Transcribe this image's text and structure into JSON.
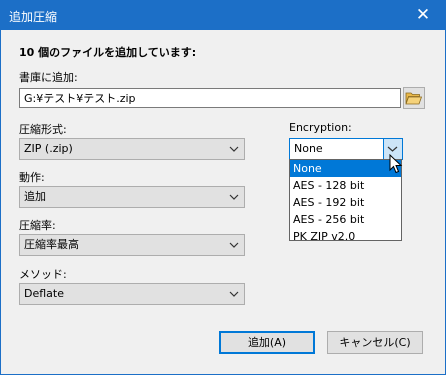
{
  "window": {
    "title": "追加圧縮",
    "close_glyph": "✕"
  },
  "heading": "10 個のファイルを追加しています:",
  "archive": {
    "label": "書庫に追加:",
    "path": "G:¥テスト¥テスト.zip"
  },
  "format": {
    "label": "圧縮形式:",
    "value": "ZIP (.zip)"
  },
  "action": {
    "label": "動作:",
    "value": "追加"
  },
  "level": {
    "label": "圧縮率:",
    "value": "圧縮率最高"
  },
  "method": {
    "label": "メソッド:",
    "value": "Deflate"
  },
  "encryption": {
    "label": "Encryption:",
    "value": "None",
    "options": [
      "None",
      "AES - 128 bit",
      "AES - 192 bit",
      "AES - 256 bit",
      "PK ZIP v2.0"
    ]
  },
  "buttons": {
    "ok": "追加(A)",
    "cancel": "キャンセル(C)"
  },
  "icons": {
    "browse": "folder-open-icon",
    "dropdown": "chevron-down-icon",
    "cursor": "mouse-pointer-icon"
  },
  "colors": {
    "accent": "#0078d7",
    "titlebar": "#1c6fc7",
    "dialog_bg": "#f0f0f0"
  }
}
